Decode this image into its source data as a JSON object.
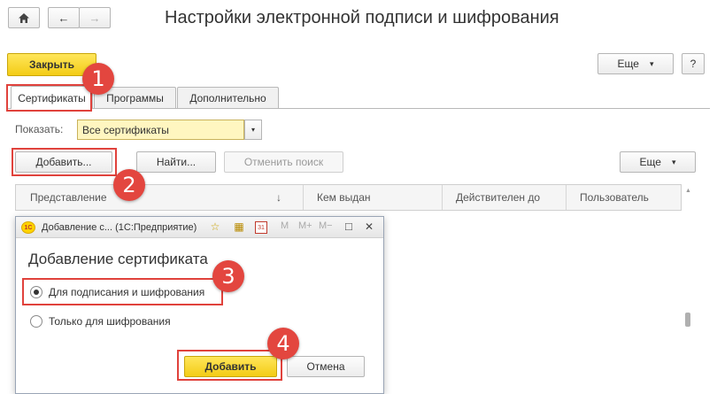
{
  "window": {
    "title": "Настройки электронной подписи и шифрования"
  },
  "nav": {
    "home_icon": "home-icon",
    "back_glyph": "←",
    "forward_glyph": "→"
  },
  "toolbar": {
    "close_label": "Закрыть",
    "more_label": "Еще",
    "more_caret": "▾",
    "help_label": "?"
  },
  "tabs": [
    {
      "label": "Сертификаты",
      "active": true
    },
    {
      "label": "Программы",
      "active": false
    },
    {
      "label": "Дополнительно",
      "active": false
    }
  ],
  "filter": {
    "label": "Показать:",
    "value": "Все сертификаты",
    "caret": "▾"
  },
  "actions": {
    "add_label": "Добавить...",
    "find_label": "Найти...",
    "cancel_search_label": "Отменить поиск",
    "more_label": "Еще",
    "more_caret": "▾"
  },
  "grid": {
    "columns": [
      "Представление",
      "Кем выдан",
      "Действителен до",
      "Пользователь"
    ],
    "sort_glyph": "↓"
  },
  "dialog": {
    "title": "Добавление с... (1С:Предприятие)",
    "logo_text": "1С",
    "toolbar_icons": [
      "☆",
      "▦",
      "31",
      "M",
      "M+",
      "M−"
    ],
    "window_controls": [
      "□",
      "✕"
    ],
    "heading": "Добавление сертификата",
    "options": [
      {
        "label": "Для подписания и шифрования",
        "checked": true
      },
      {
        "label": "Только для шифрования",
        "checked": false
      }
    ],
    "add_label": "Добавить",
    "cancel_label": "Отмена"
  },
  "callouts": [
    "1",
    "2",
    "3",
    "4"
  ],
  "colors": {
    "accent_yellow": "#f7d52a",
    "callout_red": "#e3463f",
    "select_bg": "#fff6c0"
  }
}
